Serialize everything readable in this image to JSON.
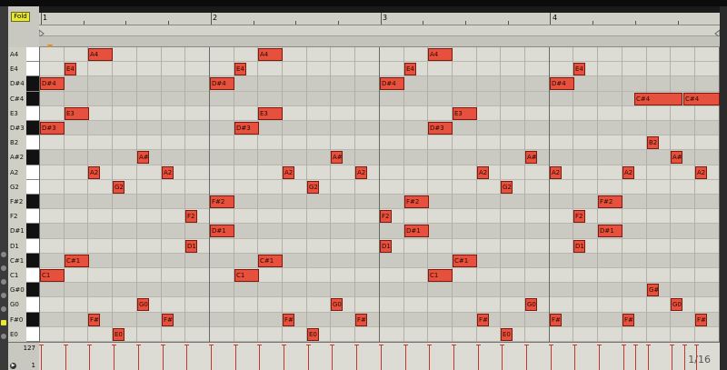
{
  "fold_button": "Fold",
  "ruler": {
    "bars": [
      "1",
      "2",
      "3",
      "4"
    ]
  },
  "key_rows": [
    "A4",
    "E4",
    "D#4",
    "C#4",
    "E3",
    "D#3",
    "B2",
    "A#2",
    "A2",
    "G2",
    "F#2",
    "F2",
    "D#1",
    "D1",
    "C#1",
    "C1",
    "G#0",
    "G0",
    "F#0",
    "E0"
  ],
  "black_keys": [
    "D#4",
    "C#4",
    "D#3",
    "A#2",
    "F#2",
    "D#1",
    "C#1",
    "G#0",
    "F#0"
  ],
  "notes": [
    {
      "row": 0,
      "start": 2.0,
      "len": 1,
      "label": "A4"
    },
    {
      "row": 0,
      "start": 9.0,
      "len": 1,
      "label": "A4"
    },
    {
      "row": 0,
      "start": 16.0,
      "len": 1,
      "label": "A4"
    },
    {
      "row": 1,
      "start": 1.0,
      "len": 0.5,
      "label": "E4"
    },
    {
      "row": 1,
      "start": 8.0,
      "len": 0.5,
      "label": "E4"
    },
    {
      "row": 1,
      "start": 15.0,
      "len": 0.5,
      "label": "E4"
    },
    {
      "row": 1,
      "start": 22.0,
      "len": 0.5,
      "label": "E4"
    },
    {
      "row": 2,
      "start": 0.0,
      "len": 1,
      "label": "D#4"
    },
    {
      "row": 2,
      "start": 7.0,
      "len": 1,
      "label": "D#4"
    },
    {
      "row": 2,
      "start": 14.0,
      "len": 1,
      "label": "D#4"
    },
    {
      "row": 2,
      "start": 21.0,
      "len": 1,
      "label": "D#4"
    },
    {
      "row": 3,
      "start": 24.5,
      "len": 2,
      "label": "C#4"
    },
    {
      "row": 3,
      "start": 26.5,
      "len": 1.5,
      "label": "C#4"
    },
    {
      "row": 4,
      "start": 1.0,
      "len": 1,
      "label": "E3"
    },
    {
      "row": 4,
      "start": 9.0,
      "len": 1,
      "label": "E3"
    },
    {
      "row": 4,
      "start": 17.0,
      "len": 1,
      "label": "E3"
    },
    {
      "row": 5,
      "start": 0.0,
      "len": 1,
      "label": "D#3"
    },
    {
      "row": 5,
      "start": 8.0,
      "len": 1,
      "label": "D#3"
    },
    {
      "row": 5,
      "start": 16.0,
      "len": 1,
      "label": "D#3"
    },
    {
      "row": 6,
      "start": 25.0,
      "len": 0.5,
      "label": "B2"
    },
    {
      "row": 7,
      "start": 4.0,
      "len": 0.5,
      "label": "A#"
    },
    {
      "row": 7,
      "start": 12.0,
      "len": 0.5,
      "label": "A#"
    },
    {
      "row": 7,
      "start": 20.0,
      "len": 0.5,
      "label": "A#"
    },
    {
      "row": 7,
      "start": 26.0,
      "len": 0.5,
      "label": "A#"
    },
    {
      "row": 8,
      "start": 2.0,
      "len": 0.5,
      "label": "A2"
    },
    {
      "row": 8,
      "start": 5.0,
      "len": 0.5,
      "label": "A2"
    },
    {
      "row": 8,
      "start": 10.0,
      "len": 0.5,
      "label": "A2"
    },
    {
      "row": 8,
      "start": 13.0,
      "len": 0.5,
      "label": "A2"
    },
    {
      "row": 8,
      "start": 18.0,
      "len": 0.5,
      "label": "A2"
    },
    {
      "row": 8,
      "start": 21.0,
      "len": 0.5,
      "label": "A2"
    },
    {
      "row": 8,
      "start": 24.0,
      "len": 0.5,
      "label": "A2"
    },
    {
      "row": 8,
      "start": 27.0,
      "len": 0.5,
      "label": "A2"
    },
    {
      "row": 9,
      "start": 3.0,
      "len": 0.5,
      "label": "G2"
    },
    {
      "row": 9,
      "start": 11.0,
      "len": 0.5,
      "label": "G2"
    },
    {
      "row": 9,
      "start": 19.0,
      "len": 0.5,
      "label": "G2"
    },
    {
      "row": 10,
      "start": 7.0,
      "len": 1,
      "label": "F#2"
    },
    {
      "row": 10,
      "start": 15.0,
      "len": 1,
      "label": "F#2"
    },
    {
      "row": 10,
      "start": 23.0,
      "len": 1,
      "label": "F#2"
    },
    {
      "row": 11,
      "start": 6.0,
      "len": 0.5,
      "label": "F2"
    },
    {
      "row": 11,
      "start": 14.0,
      "len": 0.5,
      "label": "F2"
    },
    {
      "row": 11,
      "start": 22.0,
      "len": 0.5,
      "label": "F2"
    },
    {
      "row": 12,
      "start": 7.0,
      "len": 1,
      "label": "D#1"
    },
    {
      "row": 12,
      "start": 15.0,
      "len": 1,
      "label": "D#1"
    },
    {
      "row": 12,
      "start": 23.0,
      "len": 1,
      "label": "D#1"
    },
    {
      "row": 13,
      "start": 6.0,
      "len": 0.5,
      "label": "D1"
    },
    {
      "row": 13,
      "start": 14.0,
      "len": 0.5,
      "label": "D1"
    },
    {
      "row": 13,
      "start": 22.0,
      "len": 0.5,
      "label": "D1"
    },
    {
      "row": 14,
      "start": 1.0,
      "len": 1,
      "label": "C#1"
    },
    {
      "row": 14,
      "start": 9.0,
      "len": 1,
      "label": "C#1"
    },
    {
      "row": 14,
      "start": 17.0,
      "len": 1,
      "label": "C#1"
    },
    {
      "row": 15,
      "start": 0.0,
      "len": 1,
      "label": "C1"
    },
    {
      "row": 15,
      "start": 8.0,
      "len": 1,
      "label": "C1"
    },
    {
      "row": 15,
      "start": 16.0,
      "len": 1,
      "label": "C1"
    },
    {
      "row": 16,
      "start": 25.0,
      "len": 0.5,
      "label": "G#"
    },
    {
      "row": 17,
      "start": 4.0,
      "len": 0.5,
      "label": "G0"
    },
    {
      "row": 17,
      "start": 12.0,
      "len": 0.5,
      "label": "G0"
    },
    {
      "row": 17,
      "start": 20.0,
      "len": 0.5,
      "label": "G0"
    },
    {
      "row": 17,
      "start": 26.0,
      "len": 0.5,
      "label": "G0"
    },
    {
      "row": 18,
      "start": 2.0,
      "len": 0.5,
      "label": "F#"
    },
    {
      "row": 18,
      "start": 5.0,
      "len": 0.5,
      "label": "F#"
    },
    {
      "row": 18,
      "start": 10.0,
      "len": 0.5,
      "label": "F#"
    },
    {
      "row": 18,
      "start": 13.0,
      "len": 0.5,
      "label": "F#"
    },
    {
      "row": 18,
      "start": 18.0,
      "len": 0.5,
      "label": "F#"
    },
    {
      "row": 18,
      "start": 21.0,
      "len": 0.5,
      "label": "F#"
    },
    {
      "row": 18,
      "start": 24.0,
      "len": 0.5,
      "label": "F#"
    },
    {
      "row": 18,
      "start": 27.0,
      "len": 0.5,
      "label": "F#"
    },
    {
      "row": 19,
      "start": 3.0,
      "len": 0.5,
      "label": "E0"
    },
    {
      "row": 19,
      "start": 11.0,
      "len": 0.5,
      "label": "E0"
    },
    {
      "row": 19,
      "start": 19.0,
      "len": 0.5,
      "label": "E0"
    }
  ],
  "velocity_lane": {
    "max_label": "127",
    "min_label": "1"
  },
  "quantize": "1/16",
  "colors": {
    "note_fill": "#e6503c",
    "grid_light": "#dcdcd4",
    "grid_dark": "#cacac2"
  }
}
